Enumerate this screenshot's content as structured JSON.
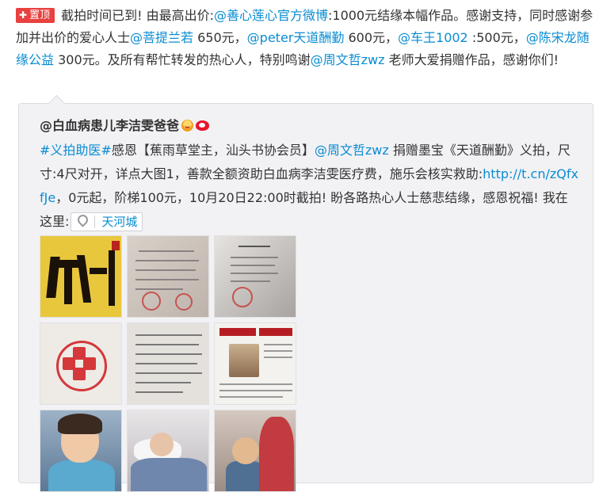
{
  "post": {
    "pin_label": "置顶",
    "segments": [
      {
        "t": "截拍时间已到! 由最高出价:"
      },
      {
        "t": "@善心莲心官方微博",
        "m": true
      },
      {
        "t": ":1000元结缘本幅作品。感谢支持，同时感谢参加并出价的爱心人士"
      },
      {
        "t": "@菩提兰若",
        "m": true
      },
      {
        "t": " 650元，"
      },
      {
        "t": "@peter天道酬勤",
        "m": true
      },
      {
        "t": " 600元，"
      },
      {
        "t": "@车王1002",
        "m": true
      },
      {
        "t": " :500元，"
      },
      {
        "t": "@陈宋龙随缘公益",
        "m": true
      },
      {
        "t": " 300元。及所有帮忙转发的热心人，特别鸣谢"
      },
      {
        "t": "@周文哲zwz",
        "m": true
      },
      {
        "t": " 老师大爱捐赠作品，感谢你们!"
      }
    ]
  },
  "repost": {
    "author": "@白血病患儿李洁雯爸爸",
    "segments": [
      {
        "t": "#义拍助医#",
        "m": true
      },
      {
        "t": "感恩【蕉雨草堂主，汕头书协会员】"
      },
      {
        "t": "@周文哲zwz",
        "m": true
      },
      {
        "t": " 捐赠墨宝《天道酬勤》义拍，尺寸:4尺对开，详点大图1，善款全额资助白血病李洁雯医疗费，施乐会核实救助:"
      },
      {
        "t": "http://t.cn/zQfxfJe",
        "m": true
      },
      {
        "t": "，0元起，阶梯100元，10月20日22:00时截拍! 盼各路热心人士慈悲结缘，感恩祝福! 我在这里:"
      }
    ],
    "location": "天河城",
    "thumbnails": [
      "calligraphy",
      "document",
      "receipt",
      "hospital-logo",
      "handwriting",
      "newspaper",
      "child-photo",
      "hospital-bed",
      "bedside"
    ]
  },
  "colors": {
    "link": "#0a8cd2",
    "pin": "#e8413f",
    "repost_bg": "#f2f2f5"
  }
}
